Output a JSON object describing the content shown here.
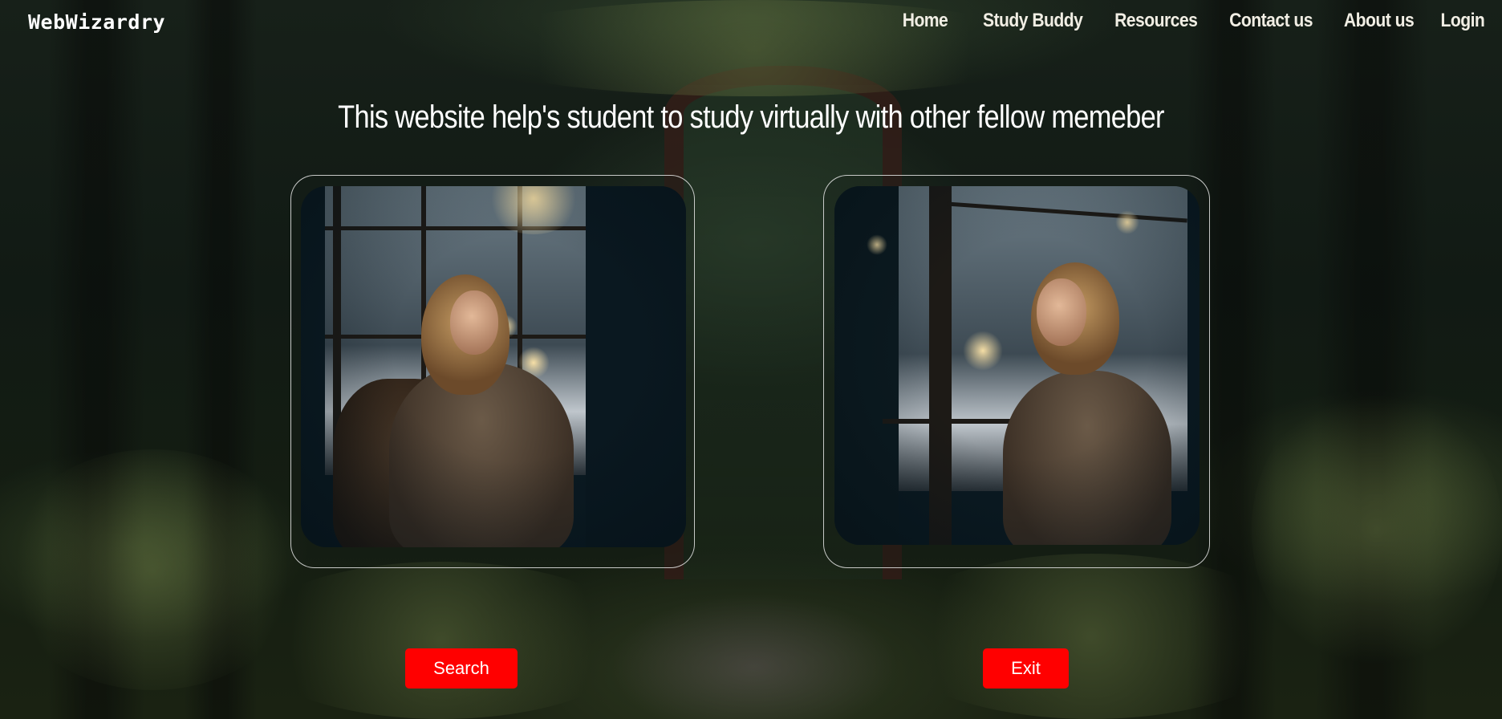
{
  "brand": {
    "name": "WebWizardry"
  },
  "nav": {
    "items": [
      {
        "label": "Home"
      },
      {
        "label": "Study Buddy"
      },
      {
        "label": "Resources"
      },
      {
        "label": "Contact us"
      },
      {
        "label": "About us"
      },
      {
        "label": "Login"
      }
    ]
  },
  "hero": {
    "headline": "This website help's student to study virtually with other fellow memeber"
  },
  "cards": {
    "left_image": "woman-by-window-photo",
    "right_image": "woman-by-window-photo"
  },
  "actions": {
    "search_label": "Search",
    "exit_label": "Exit"
  },
  "colors": {
    "button": "#ff0000",
    "text": "#ffffff",
    "background": "#141d12"
  }
}
